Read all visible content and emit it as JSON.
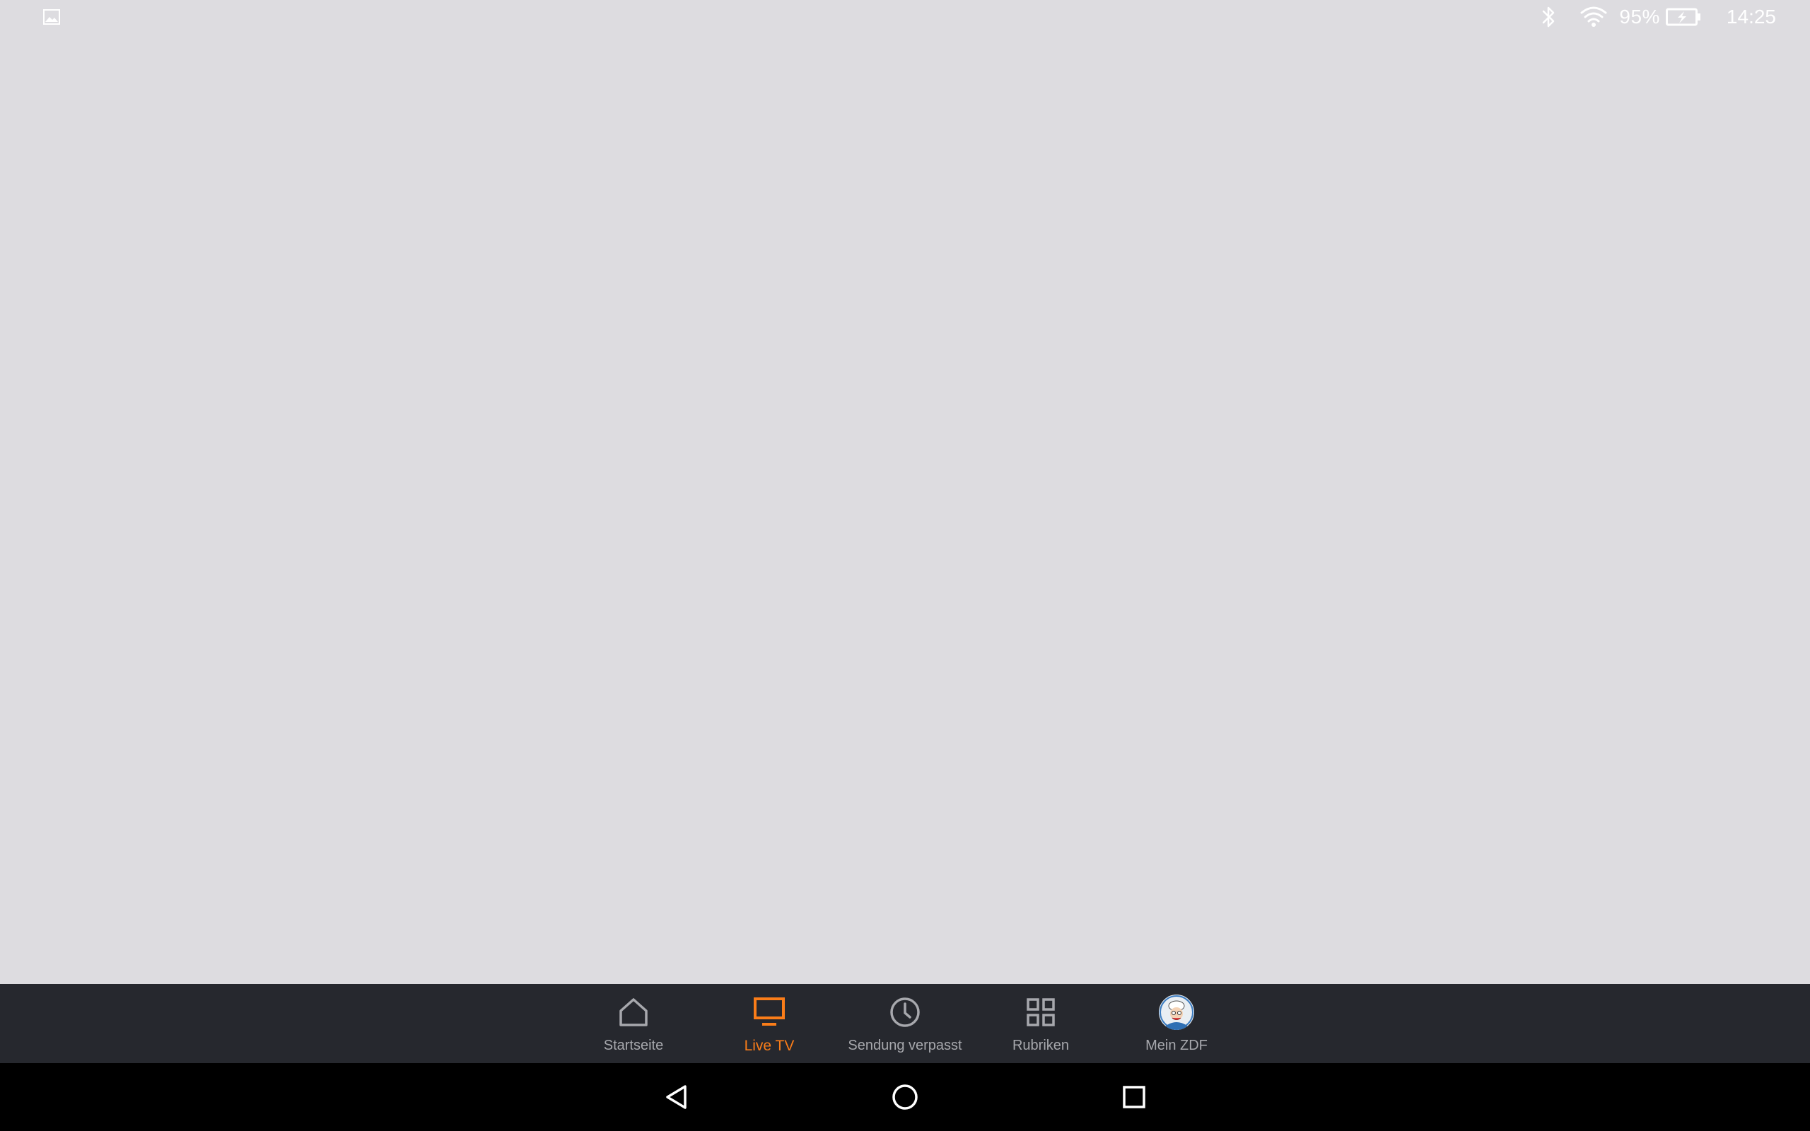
{
  "status_bar": {
    "notification_icon": "image-icon",
    "battery_percent": "95%",
    "time": "14:25",
    "icons": [
      "bluetooth-icon",
      "wifi-icon",
      "battery-charging-icon"
    ]
  },
  "bottom_nav": {
    "active_color": "#fa7d19",
    "inactive_color": "#a7a8ad",
    "items": [
      {
        "label": "Startseite",
        "icon": "home-icon",
        "active": false
      },
      {
        "label": "Live TV",
        "icon": "tv-icon",
        "active": true
      },
      {
        "label": "Sendung verpasst",
        "icon": "clock-icon",
        "active": false
      },
      {
        "label": "Rubriken",
        "icon": "grid-icon",
        "active": false
      },
      {
        "label": "Mein ZDF",
        "icon": "avatar-icon",
        "active": false
      }
    ]
  },
  "system_nav": {
    "buttons": [
      "back-icon",
      "home-circle-icon",
      "recents-icon"
    ]
  }
}
